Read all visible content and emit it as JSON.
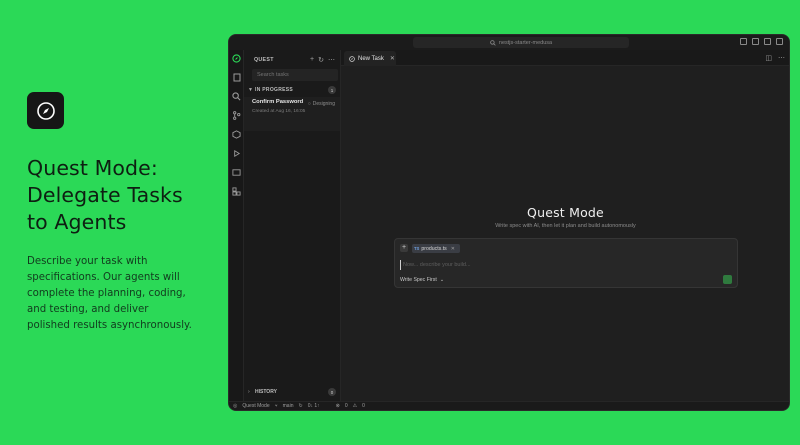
{
  "intro": {
    "headline_lines": [
      "Quest Mode:",
      "Delegate Tasks",
      "to Agents"
    ],
    "description_lines": [
      "Describe your task with",
      "specifications. Our agents will",
      "complete the planning, coding,",
      "and testing, and deliver",
      "polished results asynchronously."
    ]
  },
  "window": {
    "search_text": "nestjs-starter-medusa",
    "colors": {
      "accent_green": "#2bd957",
      "window_bg": "#1d1d1d"
    }
  },
  "activity_bar": {
    "icons": [
      "quest-icon",
      "files-icon",
      "search-icon",
      "source-control-icon",
      "extensions-icon",
      "run-debug-icon",
      "terminal-icon",
      "extensions-grid-icon"
    ]
  },
  "sidebar": {
    "title": "QUEST",
    "search_placeholder": "Search tasks",
    "in_progress": {
      "label": "IN PROGRESS",
      "count": "1"
    },
    "task": {
      "title": "Confirm Password",
      "status": "Designing",
      "meta": "Created at Aug 16, 16:05"
    },
    "history": {
      "label": "HISTORY",
      "count": "0"
    }
  },
  "editor": {
    "tab_label": "New Task",
    "quest_title": "Quest Mode",
    "quest_subtitle": "Write spec with AI, then let it plan and build autonomously",
    "composer": {
      "add_label": "+",
      "chip_prefix": "TS",
      "chip_label": "products.ts",
      "input_placeholder": "Now... describe your build...",
      "mode_label": "Write Spec First"
    }
  },
  "statusbar": {
    "mode": "Quest Mode",
    "branch": "main",
    "sync": "0↓ 1↑",
    "problems": "0",
    "warnings": "0"
  }
}
